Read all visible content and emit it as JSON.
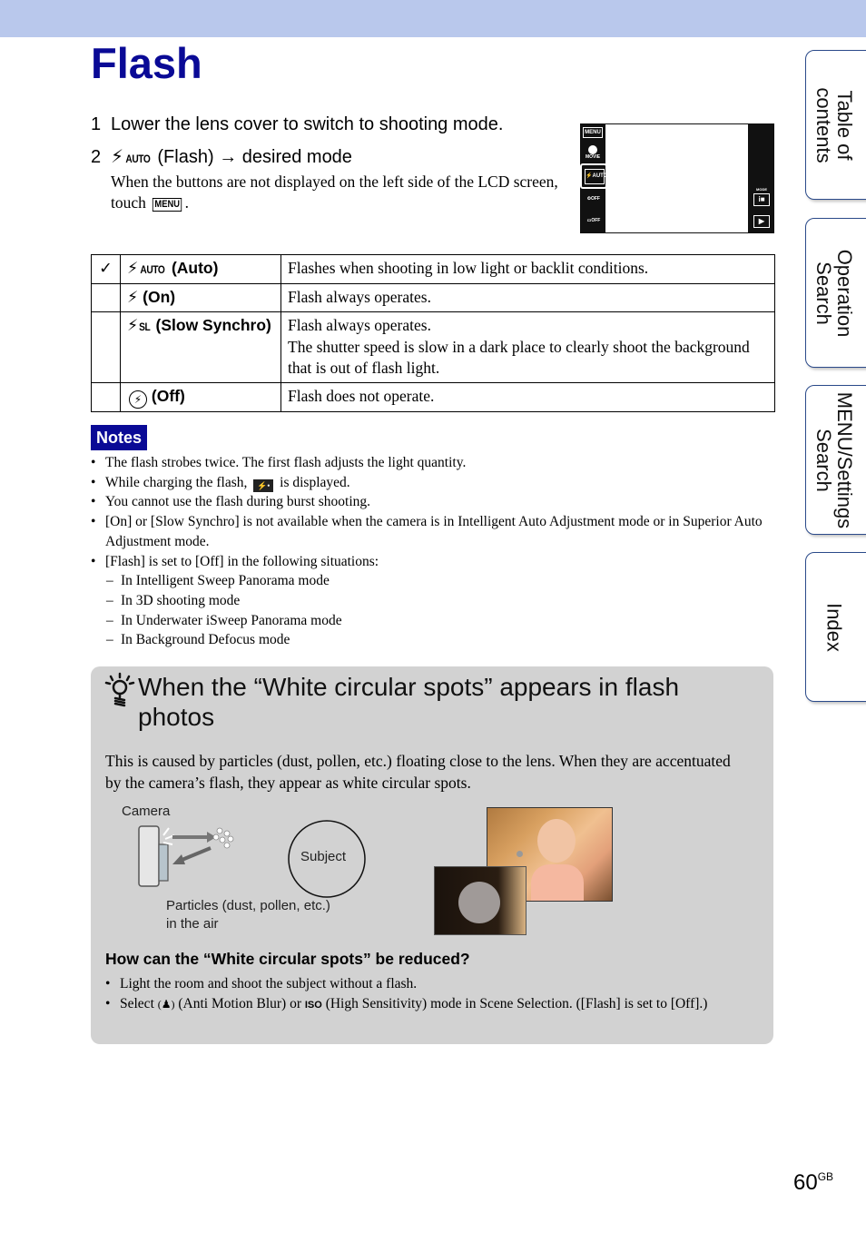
{
  "page": {
    "title": "Flash",
    "page_number": "60",
    "page_suffix": "GB",
    "colors": {
      "header_bar": "#b9c8ec",
      "title": "#0a0a96",
      "notes_badge": "#0a0a96",
      "hint_box": "#d2d2d2",
      "tab_border": "#2b4a8a"
    }
  },
  "steps": [
    {
      "num": "1",
      "text": "Lower the lens cover to switch to shooting mode."
    },
    {
      "num": "2",
      "icon": "flash-auto-icon",
      "icon_text": "AUTO",
      "text_a": "(Flash)",
      "arrow": "→",
      "text_b": "desired mode",
      "note_a": "When the buttons are not displayed on the left side of the LCD screen, touch",
      "note_key": "MENU",
      "note_b": "."
    }
  ],
  "lcd": {
    "left_buttons": [
      "MENU",
      "MOVIE",
      "AUTO",
      "OFF",
      "OFF"
    ],
    "right_buttons": [
      "MODE",
      "play"
    ]
  },
  "modes_table": {
    "rows": [
      {
        "default": true,
        "check": "✓",
        "icon": "flash-auto-icon",
        "icon_text": "AUTO",
        "label": "(Auto)",
        "desc": [
          "Flashes when shooting in low light or backlit conditions."
        ]
      },
      {
        "default": false,
        "icon": "flash-on-icon",
        "icon_text": "",
        "label": "(On)",
        "desc": [
          "Flash always operates."
        ]
      },
      {
        "default": false,
        "icon": "flash-slow-synchro-icon",
        "icon_text": "SL",
        "label": "(Slow Synchro)",
        "desc": [
          "Flash always operates.",
          "The shutter speed is slow in a dark place to clearly shoot the background that is out of flash light."
        ]
      },
      {
        "default": false,
        "icon": "flash-off-icon",
        "icon_text": "",
        "label": "(Off)",
        "desc": [
          "Flash does not operate."
        ]
      }
    ]
  },
  "notes": {
    "badge": "Notes",
    "items": [
      {
        "text": "The flash strobes twice. The first flash adjusts the light quantity."
      },
      {
        "text_a": "While charging the flash,",
        "text_b": "is displayed."
      },
      {
        "text": "You cannot use the flash during burst shooting."
      },
      {
        "text": "[On] or [Slow Synchro] is not available when the camera is in Intelligent Auto Adjustment mode or in Superior Auto Adjustment mode."
      },
      {
        "text": "[Flash] is set to [Off] in the following situations:"
      }
    ],
    "sub_items": [
      "In Intelligent Sweep Panorama mode",
      "In 3D shooting mode",
      "In Underwater iSweep Panorama mode",
      "In Background Defocus mode"
    ],
    "bullet": "•",
    "dash": "–"
  },
  "hint": {
    "title": "When the “White circular spots” appears in flash photos",
    "body": "This is caused by particles (dust, pollen, etc.) floating close to the lens. When they are accentuated by the camera’s flash, they appear as white circular spots.",
    "diagram": {
      "camera_label": "Camera",
      "subject_label": "Subject",
      "particles_label_1": "Particles (dust, pollen, etc.)",
      "particles_label_2": "in the air"
    },
    "question": "How can the “White circular spots” be reduced?",
    "answers": [
      {
        "text": "Light the room and shoot the subject without a flash."
      },
      {
        "text_a": "Select",
        "text_b": "(Anti Motion Blur) or",
        "text_c": "(High Sensitivity) mode in Scene Selection. ([Flash] is set to [Off].)"
      }
    ]
  },
  "side_tabs": [
    {
      "label": "Table of\ncontents"
    },
    {
      "label": "Operation\nSearch"
    },
    {
      "label": "MENU/Settings\nSearch"
    },
    {
      "label": "Index"
    }
  ]
}
